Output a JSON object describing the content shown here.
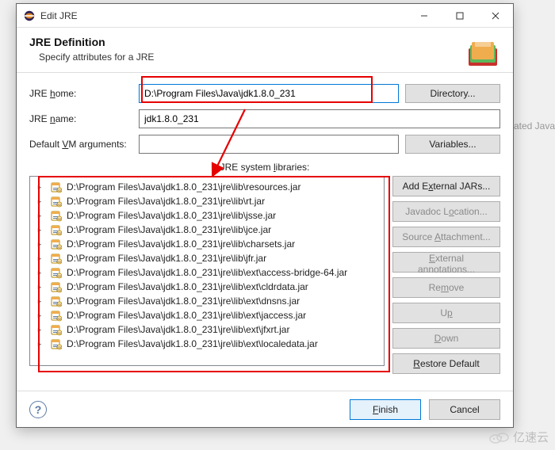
{
  "window": {
    "title": "Edit JRE"
  },
  "header": {
    "title": "JRE Definition",
    "subtitle": "Specify attributes for a JRE"
  },
  "labels": {
    "jre_home_pre": "JRE ",
    "jre_home_mn": "h",
    "jre_home_post": "ome:",
    "jre_name_pre": "JRE ",
    "jre_name_mn": "n",
    "jre_name_post": "ame:",
    "default_vm_pre": "Default ",
    "default_vm_mn": "V",
    "default_vm_post": "M arguments:",
    "libs_pre": "JRE system ",
    "libs_mn": "l",
    "libs_post": "ibraries:"
  },
  "fields": {
    "jre_home": "D:\\Program Files\\Java\\jdk1.8.0_231",
    "jre_name": "jdk1.8.0_231",
    "default_vm": ""
  },
  "buttons": {
    "directory": "Directory...",
    "variables": "Variables...",
    "add_ext_pre": "Add E",
    "add_ext_mn": "x",
    "add_ext_post": "ternal JARs...",
    "javadoc_pre": "Javadoc L",
    "javadoc_mn": "o",
    "javadoc_post": "cation...",
    "source_pre": "Source ",
    "source_mn": "A",
    "source_post": "ttachment...",
    "ext_ann_pre": "",
    "ext_ann_mn": "E",
    "ext_ann_post": "xternal annotations...",
    "remove_pre": "Re",
    "remove_mn": "m",
    "remove_post": "ove",
    "up_pre": "U",
    "up_mn": "p",
    "up_post": "",
    "down_pre": "",
    "down_mn": "D",
    "down_post": "own",
    "restore_pre": "",
    "restore_mn": "R",
    "restore_post": "estore Default",
    "finish_pre": "",
    "finish_mn": "F",
    "finish_post": "inish",
    "cancel": "Cancel"
  },
  "libs": [
    "D:\\Program Files\\Java\\jdk1.8.0_231\\jre\\lib\\resources.jar",
    "D:\\Program Files\\Java\\jdk1.8.0_231\\jre\\lib\\rt.jar",
    "D:\\Program Files\\Java\\jdk1.8.0_231\\jre\\lib\\jsse.jar",
    "D:\\Program Files\\Java\\jdk1.8.0_231\\jre\\lib\\jce.jar",
    "D:\\Program Files\\Java\\jdk1.8.0_231\\jre\\lib\\charsets.jar",
    "D:\\Program Files\\Java\\jdk1.8.0_231\\jre\\lib\\jfr.jar",
    "D:\\Program Files\\Java\\jdk1.8.0_231\\jre\\lib\\ext\\access-bridge-64.jar",
    "D:\\Program Files\\Java\\jdk1.8.0_231\\jre\\lib\\ext\\cldrdata.jar",
    "D:\\Program Files\\Java\\jdk1.8.0_231\\jre\\lib\\ext\\dnsns.jar",
    "D:\\Program Files\\Java\\jdk1.8.0_231\\jre\\lib\\ext\\jaccess.jar",
    "D:\\Program Files\\Java\\jdk1.8.0_231\\jre\\lib\\ext\\jfxrt.jar",
    "D:\\Program Files\\Java\\jdk1.8.0_231\\jre\\lib\\ext\\localedata.jar"
  ],
  "footer": {},
  "background": {
    "text": "ated Java"
  },
  "watermark": "亿速云"
}
